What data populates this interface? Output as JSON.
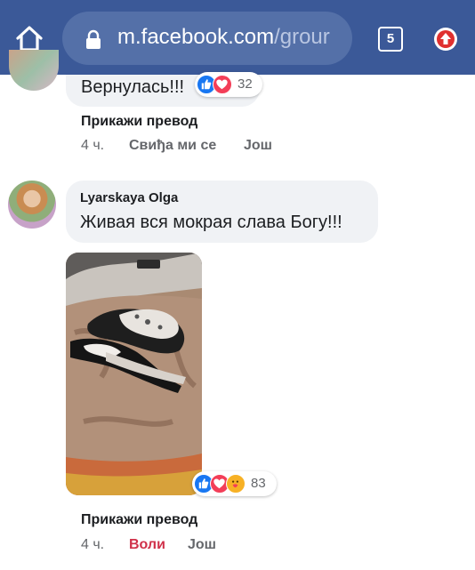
{
  "browser": {
    "url_host": "m.facebook.com",
    "url_path": "/grour",
    "tab_count": "5",
    "colors": {
      "bar": "#3b5998",
      "url_field": "#5470a8"
    }
  },
  "comment1": {
    "text": "Вернулась!!!",
    "reaction_count": "32",
    "translate": "Прикажи превод",
    "time": "4 ч.",
    "like": "Свиђа ми се",
    "more": "Још"
  },
  "comment2": {
    "author": "Lyarskaya Olga",
    "text": "Живая вся мокрая слава Богу!!!",
    "reaction_count": "83",
    "translate": "Прикажи превод",
    "time": "4 ч.",
    "like": "Воли",
    "more": "Још",
    "like_color": "#d0314a"
  }
}
